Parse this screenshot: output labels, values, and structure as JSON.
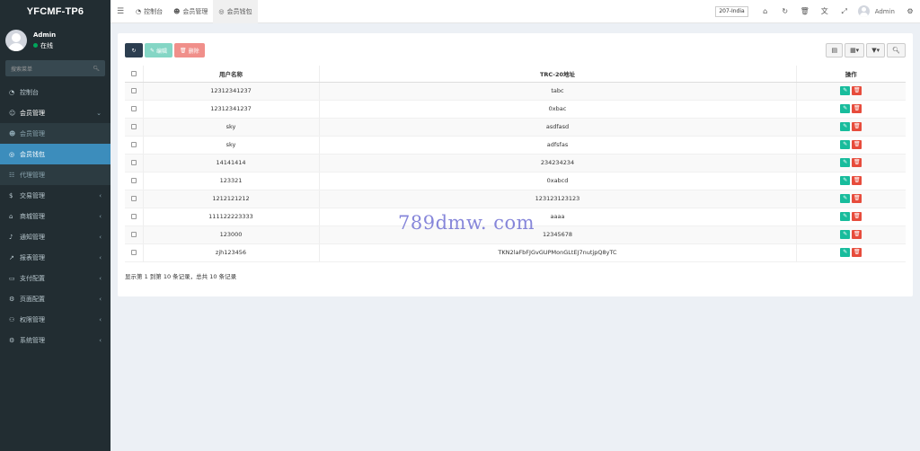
{
  "sidebar": {
    "logo": "YFCMF-TP6",
    "user_name": "Admin",
    "user_status": "在线",
    "search_placeholder": "搜索菜单",
    "menu": [
      {
        "label": "控制台",
        "icon": "dashboard-icon",
        "state": "normal",
        "arrow": ""
      },
      {
        "label": "会员管理",
        "icon": "user-group-icon",
        "state": "open",
        "arrow": "⌄"
      },
      {
        "label": "会员管理",
        "icon": "user-icon",
        "state": "sub",
        "arrow": ""
      },
      {
        "label": "会员钱包",
        "icon": "wallet-icon",
        "state": "active",
        "arrow": ""
      },
      {
        "label": "代理管理",
        "icon": "sitemap-icon",
        "state": "sub",
        "arrow": ""
      },
      {
        "label": "交易管理",
        "icon": "money-icon",
        "state": "normal",
        "arrow": "‹"
      },
      {
        "label": "商城管理",
        "icon": "shop-icon",
        "state": "normal",
        "arrow": "‹"
      },
      {
        "label": "通知管理",
        "icon": "bell-icon",
        "state": "normal",
        "arrow": "‹"
      },
      {
        "label": "报表管理",
        "icon": "chart-icon",
        "state": "normal",
        "arrow": "‹"
      },
      {
        "label": "支付配置",
        "icon": "card-icon",
        "state": "normal",
        "arrow": "‹"
      },
      {
        "label": "页面配置",
        "icon": "gear-icon",
        "state": "normal",
        "arrow": "‹"
      },
      {
        "label": "权限管理",
        "icon": "group-icon",
        "state": "normal",
        "arrow": "‹"
      },
      {
        "label": "系统管理",
        "icon": "cogs-icon",
        "state": "normal",
        "arrow": "‹"
      }
    ]
  },
  "header": {
    "tabs": [
      {
        "label": "控制台",
        "icon": "dashboard-icon"
      },
      {
        "label": "会员管理",
        "icon": "user-icon"
      },
      {
        "label": "会员钱包",
        "icon": "wallet-icon"
      }
    ],
    "language": "207-India",
    "user_name": "Admin"
  },
  "toolbar": {
    "edit_label": "编辑",
    "delete_label": "删除"
  },
  "table": {
    "columns": [
      "用户名称",
      "TRC-20地址",
      "操作"
    ],
    "rows": [
      {
        "username": "12312341237",
        "address": "tabc"
      },
      {
        "username": "12312341237",
        "address": "0xbac"
      },
      {
        "username": "sky",
        "address": "asdfasd"
      },
      {
        "username": "sky",
        "address": "adfsfas"
      },
      {
        "username": "14141414",
        "address": "234234234"
      },
      {
        "username": "123321",
        "address": "0xabcd"
      },
      {
        "username": "1212121212",
        "address": "123123123123"
      },
      {
        "username": "111122223333",
        "address": "aaaa"
      },
      {
        "username": "123000",
        "address": "12345678"
      },
      {
        "username": "zjh123456",
        "address": "TKN2laFbFJGvGUPMonGLtEJ7nutjpQ8yTC"
      }
    ]
  },
  "pagination_info": "显示第 1 到第 10 条记录，总共 10 条记录",
  "watermark": "789dmw. com",
  "colors": {
    "sidebar_bg": "#222d32",
    "active_menu": "#3c8dbc",
    "edit_green": "#18bc9c",
    "delete_red": "#e74c3c"
  }
}
